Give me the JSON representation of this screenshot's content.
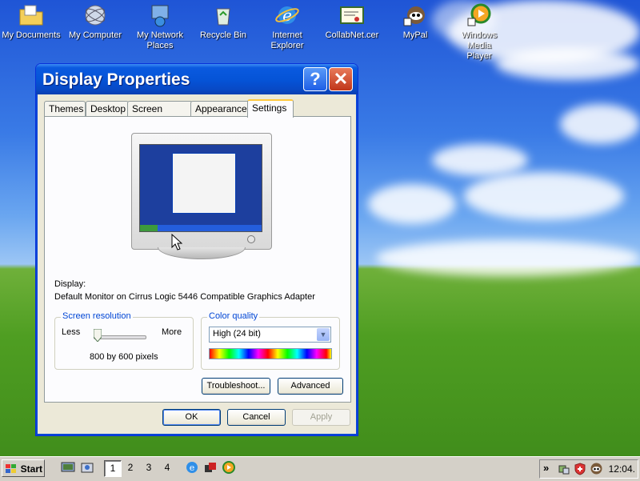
{
  "desktop": {
    "icons": [
      {
        "label": "My Documents",
        "icon": "folder-documents-icon"
      },
      {
        "label": "My Computer",
        "icon": "computer-icon"
      },
      {
        "label": "My Network\nPlaces",
        "icon": "network-places-icon"
      },
      {
        "label": "Recycle Bin",
        "icon": "recycle-bin-icon"
      },
      {
        "label": "Internet\nExplorer",
        "icon": "internet-explorer-icon"
      },
      {
        "label": "CollabNet.cer",
        "icon": "certificate-icon"
      },
      {
        "label": "MyPal",
        "icon": "mypal-icon"
      },
      {
        "label": "Windows Media\nPlayer",
        "icon": "media-player-icon"
      }
    ]
  },
  "window": {
    "title": "Display Properties",
    "help_label": "?",
    "close_label": "✕",
    "tabs": [
      "Themes",
      "Desktop",
      "Screen Saver",
      "Appearance",
      "Settings"
    ],
    "active_tab": "Settings",
    "display_label": "Display:",
    "display_value": "Default Monitor on Cirrus Logic 5446 Compatible Graphics Adapter",
    "resolution": {
      "legend": "Screen resolution",
      "less": "Less",
      "more": "More",
      "value": "800 by 600 pixels",
      "slider_fraction": 0.0
    },
    "color_quality": {
      "legend": "Color quality",
      "selected": "High (24 bit)"
    },
    "troubleshoot_label": "Troubleshoot...",
    "advanced_label": "Advanced",
    "ok_label": "OK",
    "cancel_label": "Cancel",
    "apply_label": "Apply"
  },
  "taskbar": {
    "start_label": "Start",
    "desktops": [
      "1",
      "2",
      "3",
      "4"
    ],
    "active_desktop": "1",
    "tray_chevron": "»",
    "clock": "12:04."
  },
  "colors": {
    "title_blue": "#0553d6",
    "group_legend": "#0046d5",
    "active_tab_highlight": "#ffc83c"
  }
}
